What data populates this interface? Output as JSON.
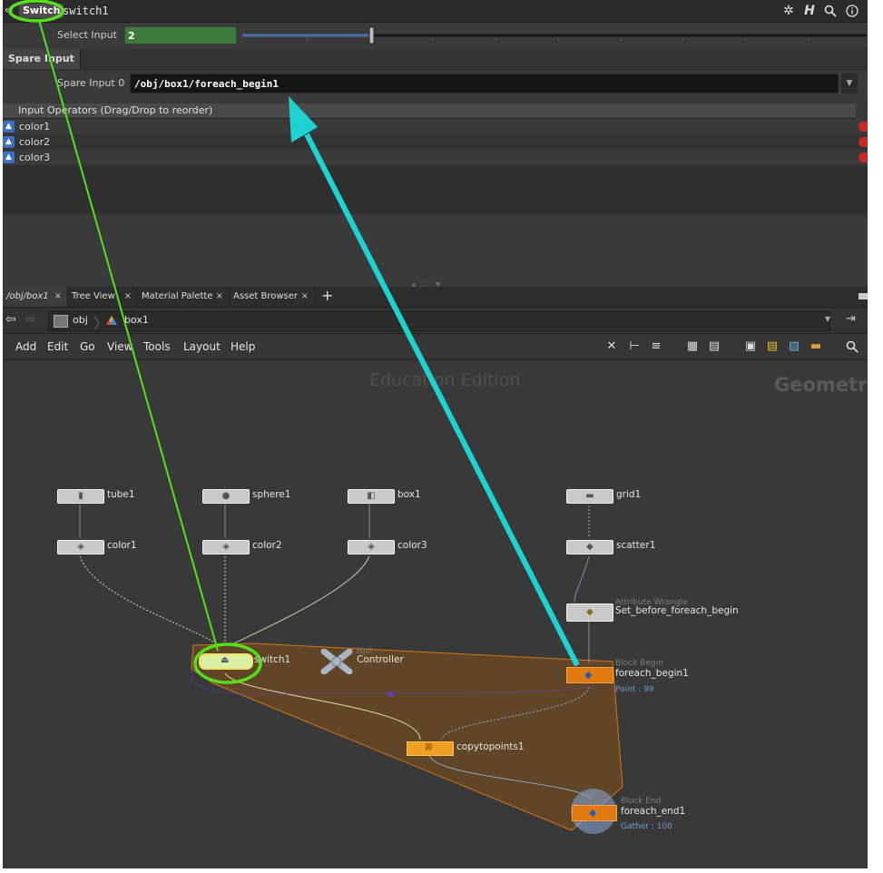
{
  "header": {
    "node_type": "Switch",
    "node_name": "switch1",
    "icons": [
      "gear-icon",
      "houdini-help-icon",
      "search-icon",
      "info-icon"
    ]
  },
  "params": {
    "select_input_label": "Select Input",
    "select_input_value": "2",
    "spare_tab": "Spare Input",
    "spare_input_label": "Spare Input 0",
    "spare_input_value": "/obj/box1/foreach_begin1",
    "input_ops_header": "Input Operators (Drag/Drop to reorder)",
    "input_ops": [
      "color1",
      "color2",
      "color3"
    ]
  },
  "pane_tabs": [
    {
      "label": "/obj/box1",
      "active": true
    },
    {
      "label": "Tree View",
      "active": false
    },
    {
      "label": "Material Palette",
      "active": false
    },
    {
      "label": "Asset Browser",
      "active": false
    }
  ],
  "path": {
    "segments": [
      "obj",
      "box1"
    ]
  },
  "menu": [
    "Add",
    "Edit",
    "Go",
    "View",
    "Tools",
    "Layout",
    "Help"
  ],
  "network": {
    "watermark": "Education Edition",
    "context_label": "Geometry",
    "nodes": {
      "tube1": "tube1",
      "sphere1": "sphere1",
      "box1": "box1",
      "grid1": "grid1",
      "color1": "color1",
      "color2": "color2",
      "color3": "color3",
      "scatter1": "scatter1",
      "wrangle_type": "Attribute Wrangle",
      "wrangle_name": "Set_before_foreach_begin",
      "switch1": "switch1",
      "null_type": "Null",
      "null_name": "Controller",
      "block_begin_type": "Block Begin",
      "block_begin_name": "foreach_begin1",
      "block_begin_stat": "Point : 99",
      "copytopoints": "copytopoints1",
      "block_end_type": "Block End",
      "block_end_name": "foreach_end1",
      "block_end_stat": "Gather : 100"
    }
  },
  "colors": {
    "annotation_green": "#55e01c",
    "annotation_cyan": "#1ed2d2",
    "node_orange": "#e07a10",
    "loop_fill": "#7a5223"
  }
}
